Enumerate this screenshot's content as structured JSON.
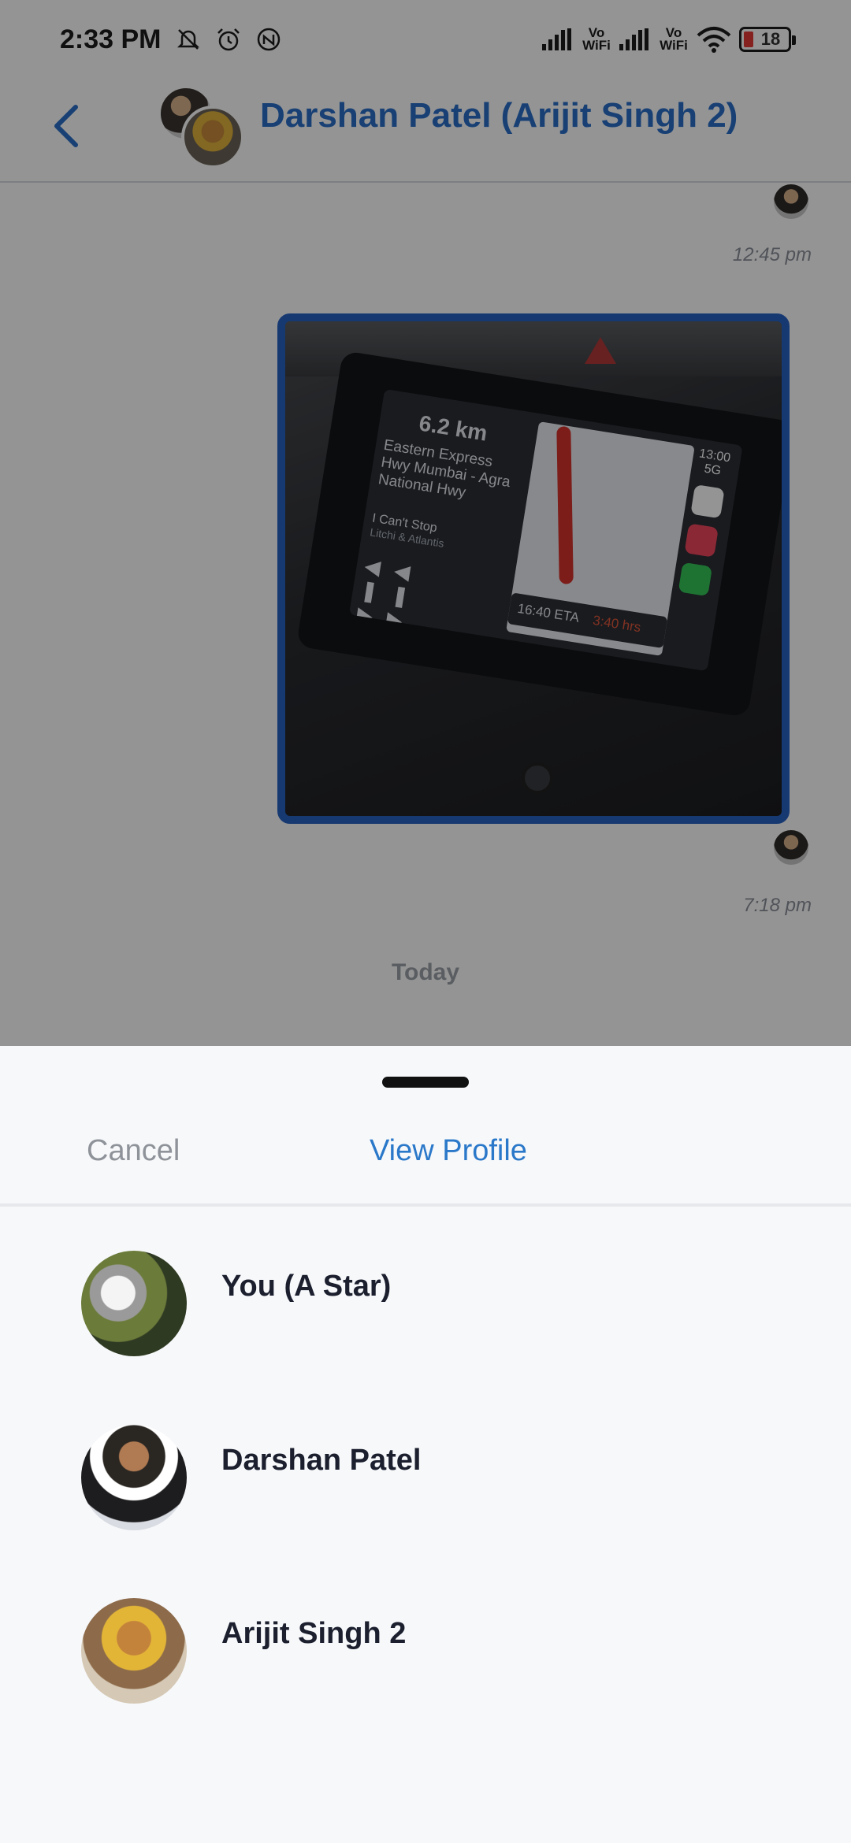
{
  "status_bar": {
    "time": "2:33 PM",
    "left_icons": [
      "mute-bell-icon",
      "alarm-icon",
      "app-notification-icon"
    ],
    "vowifi_1": "Vo\nWiFi",
    "vowifi_2": "Vo\nWiFi",
    "battery": "18",
    "battery_color": "#e53935"
  },
  "header": {
    "title": "Darshan Patel (Arijit Singh 2)",
    "accent_color": "#2a6fc9"
  },
  "chat": {
    "timestamp_1": "12:45 pm",
    "timestamp_2": "7:18 pm",
    "day_separator": "Today",
    "photo": {
      "distance": "6.2 km",
      "road": "Eastern Express Hwy Mumbai - Agra National Hwy",
      "song": "I Can't Stop",
      "artist": "Litchi & Atlantis",
      "eta": "16:40 ETA",
      "duration": "3:40 hrs",
      "clock": "13:00",
      "network": "5G"
    }
  },
  "sheet": {
    "cancel_label": "Cancel",
    "view_profile_label": "View Profile",
    "members": [
      {
        "name": "You (A Star)"
      },
      {
        "name": "Darshan Patel"
      },
      {
        "name": "Arijit Singh 2"
      }
    ]
  }
}
